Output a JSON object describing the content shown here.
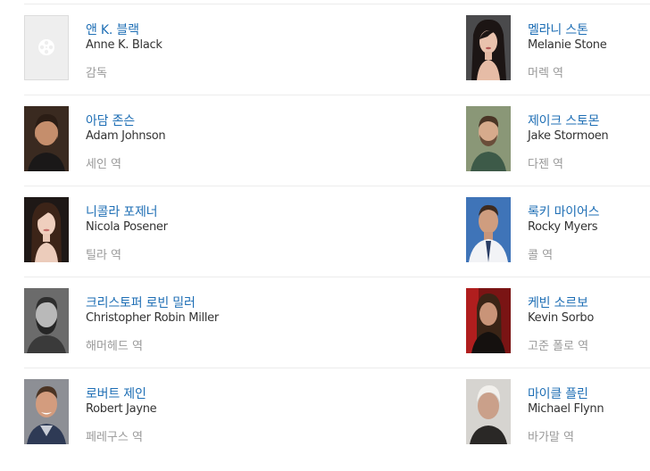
{
  "cast": [
    {
      "name_ko": "앤 K. 블랙",
      "name_en": "Anne K. Black",
      "role": "감독",
      "photo": "placeholder-film-icon"
    },
    {
      "name_ko": "멜라니 스톤",
      "name_en": "Melanie Stone",
      "role": "머렉 역",
      "photo": "portrait-dark-long-hair"
    },
    {
      "name_ko": "아담 존슨",
      "name_en": "Adam Johnson",
      "role": "세인 역",
      "photo": "portrait-bearded-man"
    },
    {
      "name_ko": "제이크 스토몬",
      "name_en": "Jake Stormoen",
      "role": "다젠 역",
      "photo": "portrait-green-shirt-man"
    },
    {
      "name_ko": "니콜라 포제너",
      "name_en": "Nicola Posener",
      "role": "틸라 역",
      "photo": "portrait-dark-hair-woman"
    },
    {
      "name_ko": "록키 마이어스",
      "name_en": "Rocky Myers",
      "role": "콜 역",
      "photo": "portrait-blue-background-man"
    },
    {
      "name_ko": "크리스토퍼 로빈 밀러",
      "name_en": "Christopher Robin Miller",
      "role": "해머헤드 역",
      "photo": "portrait-black-white-bearded-man"
    },
    {
      "name_ko": "케빈 소르보",
      "name_en": "Kevin Sorbo",
      "role": "고준 폴로 역",
      "photo": "portrait-red-background-man"
    },
    {
      "name_ko": "로버트 제인",
      "name_en": "Robert Jayne",
      "role": "페레구스 역",
      "photo": "portrait-smiling-man"
    },
    {
      "name_ko": "마이클 플린",
      "name_en": "Michael Flynn",
      "role": "바가말 역",
      "photo": "portrait-white-hair-man"
    }
  ]
}
